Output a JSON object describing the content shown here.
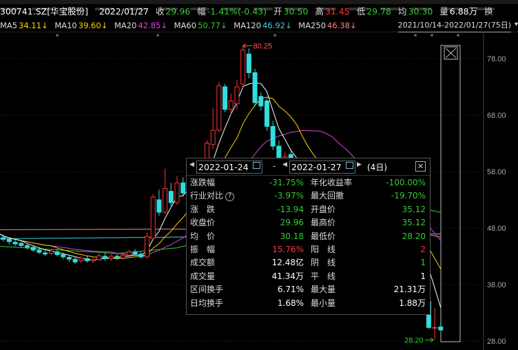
{
  "header": {
    "code": "300741.SZ[华宝股份]",
    "date": "2022/01/27",
    "close_label": "收",
    "close": "29.96",
    "change_label": "幅",
    "change": "-1.41%(-0.43)",
    "open_label": "开",
    "open": "30.50",
    "high_label": "高",
    "high": "31.45",
    "low_label": "低",
    "low": "29.78",
    "avg_label": "均",
    "avg": "30.30",
    "vol_label": "量",
    "vol": "6.88万",
    "extra": "换"
  },
  "ma_bar": [
    {
      "label": "MA5",
      "value": "34.11↓",
      "color": "#ffd400"
    },
    {
      "label": "MA10",
      "value": "39.60↓",
      "color": "#ffd400"
    },
    {
      "label": "MA20",
      "value": "42.85↓",
      "color": "#e040e0"
    },
    {
      "label": "MA60",
      "value": "50.77↓",
      "color": "#33cc33"
    },
    {
      "label": "MA120",
      "value": "46.92↓",
      "color": "#40d0e0"
    },
    {
      "label": "MA250",
      "value": "46.38↓",
      "color": "#ff8080"
    }
  ],
  "range": "2021/10/14-2022/01/27(75日)",
  "price_axis": [
    "78.00",
    "68.00",
    "58.00",
    "48.00",
    "38.00",
    "28.00"
  ],
  "annotations": {
    "high": "80.25",
    "low": "28.20"
  },
  "panel": {
    "start_date": "2022-01-24",
    "sep": "-",
    "end_date": "2022-01-27",
    "days": "(4日)",
    "rows": [
      {
        "l1": "涨跌幅",
        "v1": "-31.75%",
        "c1": "#33cc33",
        "l2": "年化收益率",
        "v2": "-100.00%",
        "c2": "#33cc33"
      },
      {
        "l1": "行业对比",
        "help": "?",
        "v1": "-3.97%",
        "c1": "#33cc33",
        "l2": "最大回撤",
        "v2": "-19.70%",
        "c2": "#33cc33"
      },
      {
        "l1": "涨　跌",
        "v1": "-13.94",
        "c1": "#33cc33",
        "l2": "开盘价",
        "v2": "35.12",
        "c2": "#33cc33"
      },
      {
        "l1": "收盘价",
        "v1": "29.96",
        "c1": "#33cc33",
        "l2": "最高价",
        "v2": "35.12",
        "c2": "#33cc33"
      },
      {
        "l1": "均　价",
        "v1": "30.18",
        "c1": "#33cc33",
        "l2": "最低价",
        "v2": "28.20",
        "c2": "#33cc33"
      },
      {
        "l1": "振　幅",
        "v1": "15.76%",
        "c1": "#ff3333",
        "l2": "阳　线",
        "v2": "2",
        "c2": "#ff3333"
      },
      {
        "l1": "成交额",
        "v1": "12.48亿",
        "c1": "#ffffff",
        "l2": "阴　线",
        "v2": "1",
        "c2": "#33cc33"
      },
      {
        "l1": "成交量",
        "v1": "41.34万",
        "c1": "#ffffff",
        "l2": "平　线",
        "v2": "1",
        "c2": "#ffffff"
      },
      {
        "l1": "区间换手",
        "v1": "6.71%",
        "c1": "#ffffff",
        "l2": "最大量",
        "v2": "21.31万",
        "c2": "#ffffff"
      },
      {
        "l1": "日均换手",
        "v1": "1.68%",
        "c1": "#ffffff",
        "l2": "最小量",
        "v2": "1.88万",
        "c2": "#ffffff"
      }
    ]
  },
  "colors": {
    "up": "#ff3333",
    "down": "#33dddd",
    "ma5": "#ffffff",
    "ma10": "#ffd400",
    "ma20": "#e040e0",
    "ma60": "#33cc33",
    "ma120": "#40d0e0",
    "ma250": "#ff8080",
    "axis": "#aaaaaa"
  },
  "candles": [
    [
      46.8,
      47.2,
      47.6,
      46.2
    ],
    [
      46.3,
      46.0,
      46.9,
      45.6
    ],
    [
      46.0,
      45.6,
      46.4,
      45.1
    ],
    [
      45.5,
      45.2,
      45.9,
      44.8
    ],
    [
      45.3,
      44.9,
      45.8,
      44.6
    ],
    [
      44.9,
      44.6,
      45.3,
      44.2
    ],
    [
      44.6,
      44.1,
      45.0,
      43.8
    ],
    [
      44.1,
      43.7,
      44.6,
      43.4
    ],
    [
      43.6,
      43.4,
      44.0,
      43.0
    ],
    [
      43.5,
      43.9,
      44.2,
      43.2
    ],
    [
      43.8,
      43.3,
      44.3,
      43.0
    ],
    [
      43.3,
      42.9,
      43.7,
      42.5
    ],
    [
      42.8,
      42.5,
      43.2,
      42.0
    ],
    [
      42.5,
      42.0,
      42.8,
      41.6
    ],
    [
      42.2,
      42.7,
      43.0,
      41.8
    ],
    [
      42.6,
      42.2,
      43.0,
      41.9
    ],
    [
      42.2,
      42.4,
      42.9,
      41.8
    ],
    [
      42.4,
      43.1,
      43.5,
      42.2
    ],
    [
      43.0,
      42.6,
      43.6,
      42.2
    ],
    [
      42.6,
      43.0,
      43.4,
      42.2
    ],
    [
      43.0,
      42.7,
      43.4,
      42.3
    ],
    [
      42.7,
      43.2,
      43.6,
      42.4
    ],
    [
      43.2,
      43.8,
      44.2,
      42.9
    ],
    [
      43.8,
      43.4,
      44.3,
      43.1
    ],
    [
      43.4,
      42.9,
      43.8,
      42.6
    ],
    [
      42.9,
      46.5,
      47.2,
      42.6
    ],
    [
      46.2,
      53.5,
      54.0,
      45.9
    ],
    [
      53.0,
      50.8,
      54.8,
      50.2
    ],
    [
      50.8,
      55.0,
      58.5,
      50.5
    ],
    [
      54.5,
      52.5,
      56.0,
      51.6
    ],
    [
      52.5,
      56.0,
      57.2,
      52.1
    ],
    [
      56.0,
      54.2,
      57.0,
      53.8
    ],
    [
      54.5,
      57.6,
      58.8,
      54.0
    ],
    [
      57.2,
      55.6,
      58.5,
      55.0
    ],
    [
      56.0,
      58.0,
      59.0,
      55.5
    ],
    [
      58.0,
      63.0,
      63.5,
      57.5
    ],
    [
      62.8,
      65.3,
      69.2,
      62.0
    ],
    [
      65.3,
      73.2,
      73.8,
      65.0
    ],
    [
      73.0,
      69.0,
      73.5,
      68.5
    ],
    [
      69.0,
      70.5,
      71.8,
      68.0
    ],
    [
      70.0,
      73.0,
      74.2,
      69.0
    ],
    [
      73.5,
      79.5,
      80.25,
      72.8
    ],
    [
      78.8,
      75.5,
      79.8,
      74.5
    ],
    [
      75.5,
      70.2,
      76.2,
      69.5
    ],
    [
      71.3,
      69.6,
      72.0,
      68.8
    ],
    [
      70.5,
      66.0,
      71.0,
      65.2
    ],
    [
      66.0,
      62.5,
      67.0,
      61.8
    ],
    [
      62.5,
      59.8,
      63.5,
      58.9
    ],
    [
      59.6,
      60.6,
      61.5,
      59.0
    ],
    [
      61.0,
      60.0,
      62.0,
      59.5
    ],
    [
      60.0,
      58.9,
      60.5,
      58.2
    ],
    [
      59.0,
      57.6,
      59.5,
      57.0
    ],
    [
      57.6,
      56.5,
      58.2,
      56.0
    ],
    [
      56.5,
      55.4,
      57.0,
      54.8
    ],
    [
      55.4,
      56.0,
      56.8,
      55.0
    ],
    [
      56.0,
      54.5,
      56.5,
      54.0
    ],
    [
      54.5,
      53.2,
      55.0,
      52.8
    ],
    [
      53.2,
      52.0,
      53.8,
      51.5
    ],
    [
      52.0,
      51.2,
      52.5,
      50.7
    ],
    [
      51.2,
      50.5,
      51.8,
      50.0
    ],
    [
      50.5,
      50.0,
      51.0,
      49.4
    ],
    [
      50.0,
      49.6,
      50.5,
      49.0
    ],
    [
      49.6,
      49.2,
      50.0,
      48.8
    ],
    [
      49.2,
      48.8,
      49.6,
      48.3
    ],
    [
      48.8,
      48.3,
      49.1,
      47.9
    ],
    [
      48.3,
      48.0,
      48.8,
      47.5
    ],
    [
      48.0,
      47.7,
      48.4,
      47.2
    ],
    [
      47.5,
      47.9,
      48.2,
      47.0
    ],
    [
      47.9,
      47.5,
      48.3,
      47.0
    ],
    [
      47.6,
      47.2,
      48.0,
      46.8
    ],
    [
      45.0,
      43.9,
      46.4,
      43.5
    ],
    [
      35.12,
      35.0,
      35.12,
      34.4
    ],
    [
      35.0,
      30.4,
      35.0,
      30.1
    ],
    [
      30.3,
      30.4,
      33.8,
      28.2
    ],
    [
      30.5,
      29.96,
      31.45,
      29.78
    ]
  ]
}
